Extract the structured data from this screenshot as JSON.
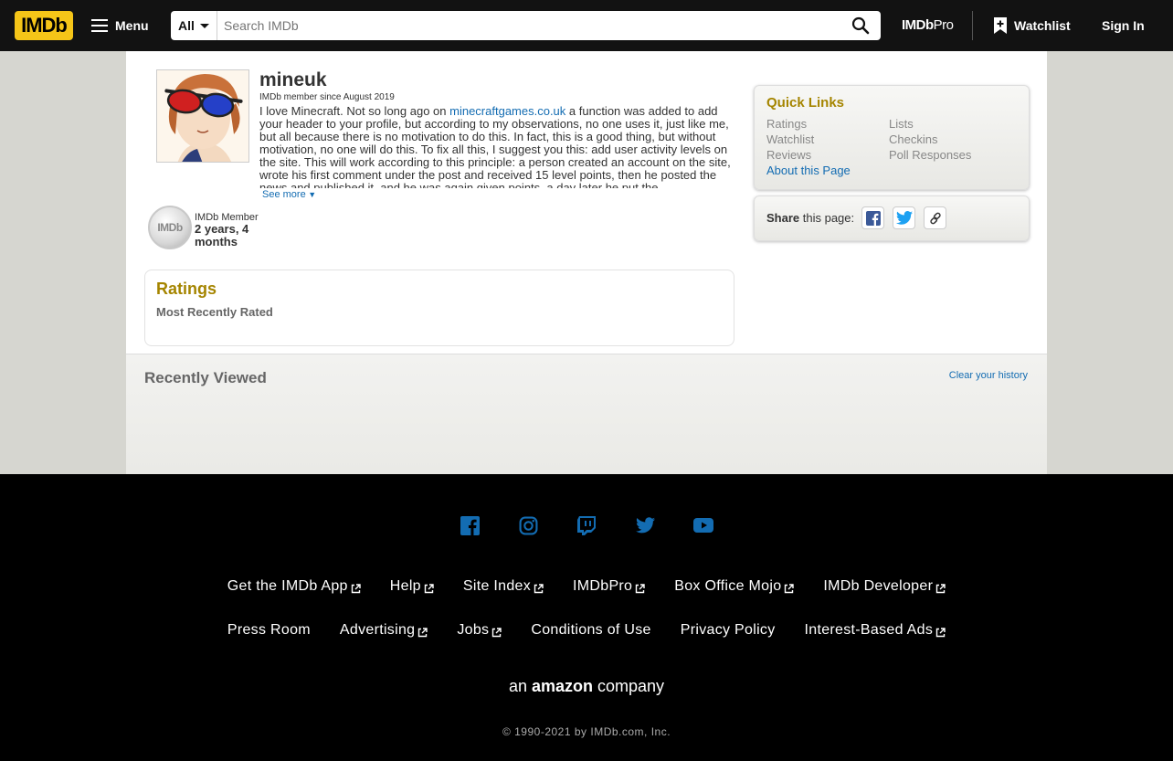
{
  "nav": {
    "logo": "IMDb",
    "menu_label": "Menu",
    "search_category": "All",
    "search_placeholder": "Search IMDb",
    "imdbpro_a": "IMDb",
    "imdbpro_b": "Pro",
    "watchlist_label": "Watchlist",
    "signin_label": "Sign In"
  },
  "profile": {
    "username": "mineuk",
    "member_since": "IMDb member since August 2019",
    "bio_prefix": "I love Minecraft. Not so long ago on ",
    "bio_link": "minecraftgames.co.uk",
    "bio_rest": " a function was added to add your header to your profile, but according to my observations, no one uses it, just like me, but all because there is no motivation to do this. In fact, this is a good thing, but without motivation, no one will do this. To fix all this, I suggest you this: add user activity levels on the site. This will work according to this principle: a person created an account on the site, wrote his first comment under the post and received 15 level points, then he posted the news and published it, and he was again given points, a day later he put the",
    "see_more": "See more",
    "badge_text": "IMDb",
    "member_label": "IMDb Member",
    "member_duration": "2 years, 4 months"
  },
  "ratings": {
    "title": "Ratings",
    "subtitle": "Most Recently Rated"
  },
  "quick_links": {
    "title": "Quick Links",
    "items": [
      "Ratings",
      "Lists",
      "Watchlist",
      "Checkins",
      "Reviews",
      "Poll Responses"
    ],
    "about": "About this Page"
  },
  "share": {
    "bold": "Share",
    "rest": " this page:"
  },
  "recently_viewed": {
    "title": "Recently Viewed",
    "clear": "Clear your history"
  },
  "footer": {
    "row1": [
      "Get the IMDb App",
      "Help",
      "Site Index",
      "IMDbPro",
      "Box Office Mojo",
      "IMDb Developer"
    ],
    "row2": [
      "Press Room",
      "Advertising",
      "Jobs",
      "Conditions of Use",
      "Privacy Policy",
      "Interest-Based Ads"
    ],
    "amazon_a": "an ",
    "amazon_b": "amazon",
    "amazon_c": " company",
    "copyright": "© 1990-2021 by IMDb.com, Inc."
  },
  "colors": {
    "brand_yellow": "#f5c518",
    "link_blue": "#136cb2",
    "heading_gold": "#a58500",
    "social_blue": "#136cb2"
  }
}
